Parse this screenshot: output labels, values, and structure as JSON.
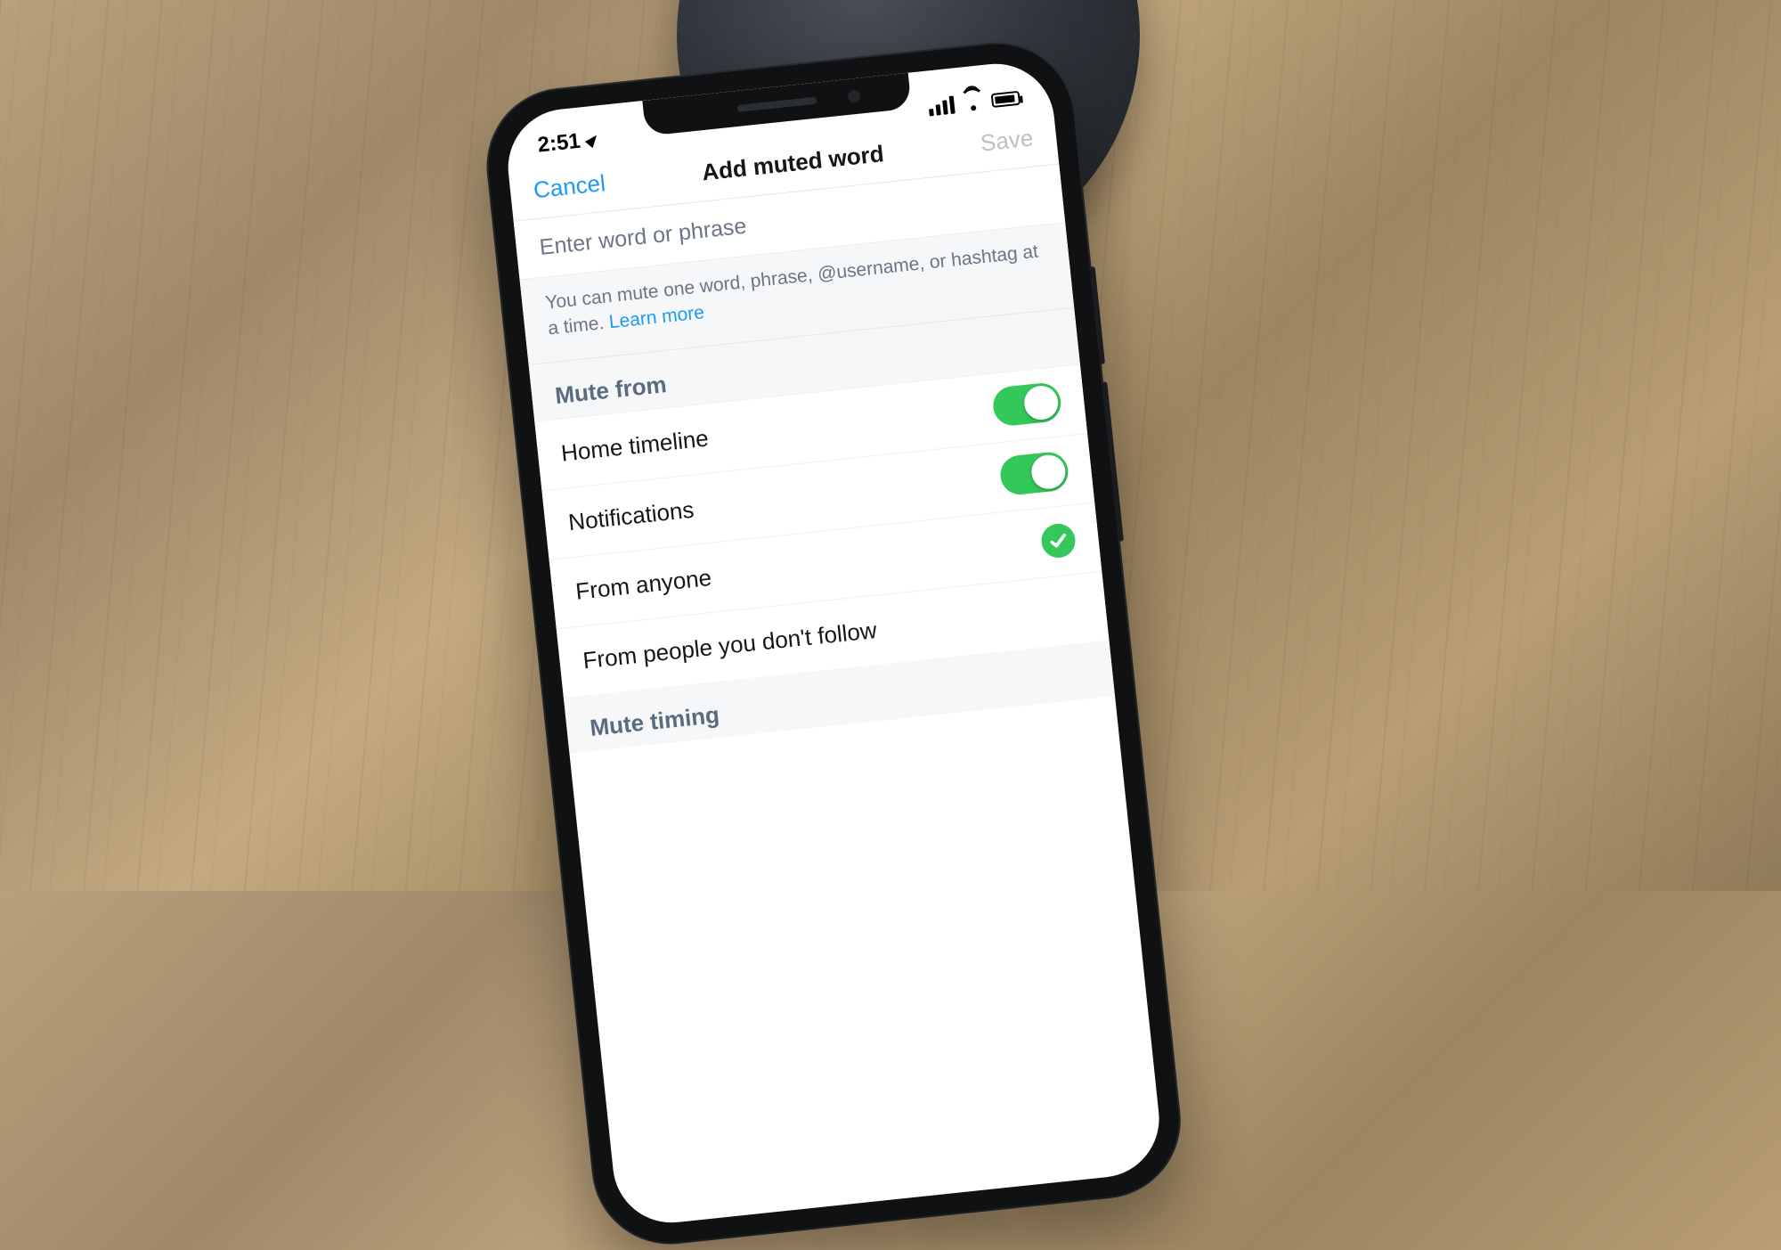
{
  "statusbar": {
    "time": "2:51"
  },
  "nav": {
    "cancel": "Cancel",
    "title": "Add muted word",
    "save": "Save"
  },
  "input": {
    "placeholder": "Enter word or phrase"
  },
  "helper": {
    "text": "You can mute one word, phrase, @username, or hashtag at a time. ",
    "link": "Learn more"
  },
  "sections": {
    "mute_from": {
      "header": "Mute from",
      "rows": {
        "home_timeline": "Home timeline",
        "notifications": "Notifications",
        "from_anyone": "From anyone",
        "from_not_follow": "From people you don't follow"
      }
    },
    "mute_timing": {
      "header": "Mute timing"
    }
  }
}
